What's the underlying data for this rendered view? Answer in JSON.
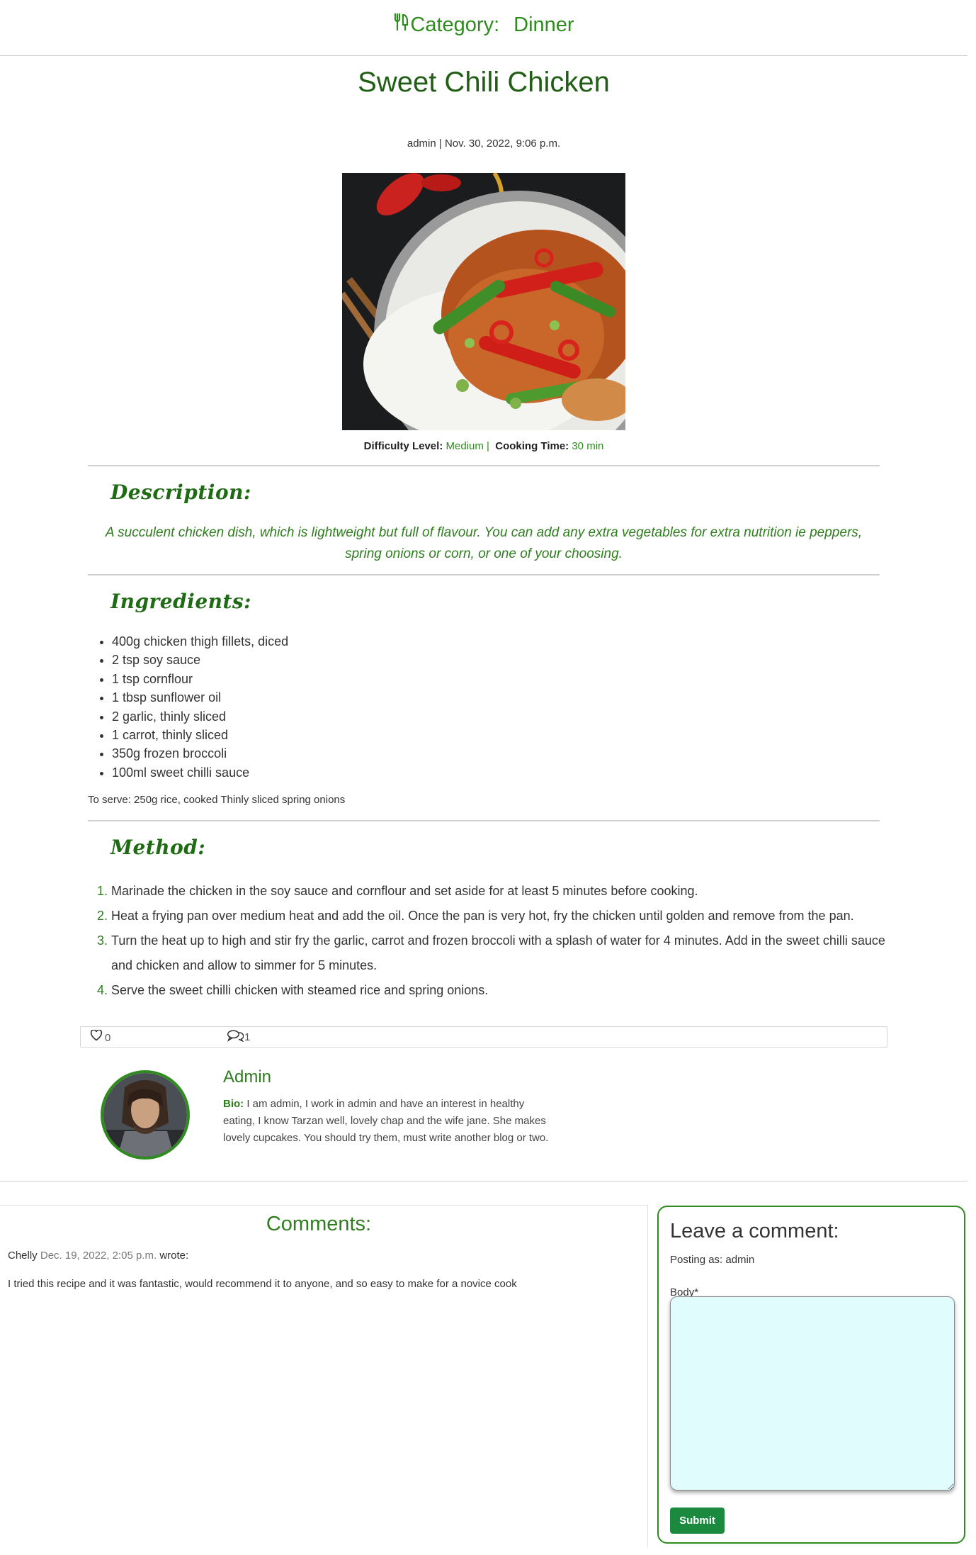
{
  "header": {
    "category_label": "Category:",
    "category_value": "Dinner"
  },
  "post": {
    "title": "Sweet Chili Chicken",
    "meta": "admin | Nov. 30, 2022, 9:06 p.m.",
    "difficulty_label": "Difficulty Level:",
    "difficulty_value": "Medium",
    "separator": "|",
    "cooking_label": "Cooking Time:",
    "cooking_value": "30 min"
  },
  "description": {
    "heading": "Description:",
    "text": "A succulent chicken dish, which is lightweight but full of flavour. You can add any extra vegetables for extra nutrition ie peppers, spring onions or corn, or one of your choosing."
  },
  "ingredients": {
    "heading": "Ingredients:",
    "items": [
      "400g chicken thigh fillets, diced",
      "2 tsp soy sauce",
      "1 tsp cornflour",
      "1 tbsp sunflower oil",
      "2 garlic, thinly sliced",
      "1 carrot, thinly sliced",
      "350g frozen broccoli",
      "100ml sweet chilli sauce"
    ],
    "serve": "To serve: 250g rice, cooked Thinly sliced spring onions"
  },
  "method": {
    "heading": "Method:",
    "steps": [
      "Marinade the chicken in the soy sauce and cornflour and set aside for at least 5 minutes before cooking.",
      "Heat a frying pan over medium heat and add the oil. Once the pan is very hot, fry the chicken until golden and remove from the pan.",
      "Turn the heat up to high and stir fry the garlic, carrot and frozen broccoli with a splash of water for 4 minutes. Add in the sweet chilli sauce and chicken and allow to simmer for 5 minutes.",
      "Serve the sweet chilli chicken with steamed rice and spring onions."
    ]
  },
  "actions": {
    "likes": "0",
    "comments": "1"
  },
  "author": {
    "name": "Admin",
    "bio_label": "Bio:",
    "bio": "I am admin, I work in admin and have an interest in healthy eating, I know Tarzan well, lovely chap and the wife jane. She makes lovely cupcakes. You should try them, must write another blog or two."
  },
  "comments": {
    "heading": "Comments:",
    "items": [
      {
        "author": "Chelly",
        "date": "Dec. 19, 2022, 2:05 p.m.",
        "wrote": "wrote:",
        "body": "I tried this recipe and it was fantastic, would recommend it to anyone, and so easy to make for a novice cook"
      }
    ]
  },
  "form": {
    "heading": "Leave a comment:",
    "posting_as": "Posting as: admin",
    "body_label": "Body*",
    "body_value": "",
    "submit": "Submit"
  },
  "colors": {
    "brand_green": "#2e8b1e",
    "dark_green": "#1f5e14",
    "submit_green": "#1b8a3e",
    "textarea_bg": "#e0fcfd"
  }
}
